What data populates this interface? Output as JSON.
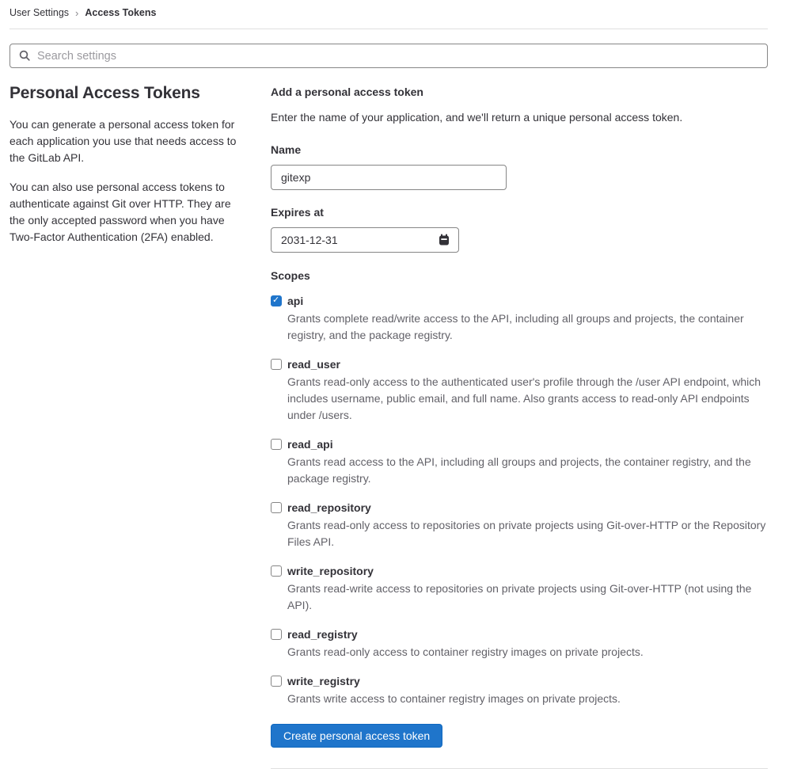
{
  "breadcrumb": {
    "separator": "›",
    "items": [
      {
        "label": "User Settings"
      },
      {
        "label": "Access Tokens"
      }
    ]
  },
  "search": {
    "placeholder": "Search settings"
  },
  "sidebar": {
    "title": "Personal Access Tokens",
    "paragraphs": [
      "You can generate a personal access token for each application you use that needs access to the GitLab API.",
      "You can also use personal access tokens to authenticate against Git over HTTP. They are the only accepted password when you have Two-Factor Authentication (2FA) enabled."
    ]
  },
  "form": {
    "title": "Add a personal access token",
    "description": "Enter the name of your application, and we'll return a unique personal access token.",
    "name_label": "Name",
    "name_value": "gitexp",
    "expires_label": "Expires at",
    "expires_value": "2031-12-31",
    "scopes_label": "Scopes",
    "scopes": [
      {
        "name": "api",
        "checked": true,
        "description": "Grants complete read/write access to the API, including all groups and projects, the container registry, and the package registry."
      },
      {
        "name": "read_user",
        "checked": false,
        "description": "Grants read-only access to the authenticated user's profile through the /user API endpoint, which includes username, public email, and full name. Also grants access to read-only API endpoints under /users."
      },
      {
        "name": "read_api",
        "checked": false,
        "description": "Grants read access to the API, including all groups and projects, the container registry, and the package registry."
      },
      {
        "name": "read_repository",
        "checked": false,
        "description": "Grants read-only access to repositories on private projects using Git-over-HTTP or the Repository Files API."
      },
      {
        "name": "write_repository",
        "checked": false,
        "description": "Grants read-write access to repositories on private projects using Git-over-HTTP (not using the API)."
      },
      {
        "name": "read_registry",
        "checked": false,
        "description": "Grants read-only access to container registry images on private projects."
      },
      {
        "name": "write_registry",
        "checked": false,
        "description": "Grants write access to container registry images on private projects."
      }
    ],
    "submit_label": "Create personal access token"
  },
  "colors": {
    "accent_blue": "#1f75cb",
    "accent_blue_border": "#1068bf",
    "text_primary": "#333238",
    "text_secondary": "#626168",
    "input_border": "#868686",
    "divider": "#e0e0e0"
  }
}
